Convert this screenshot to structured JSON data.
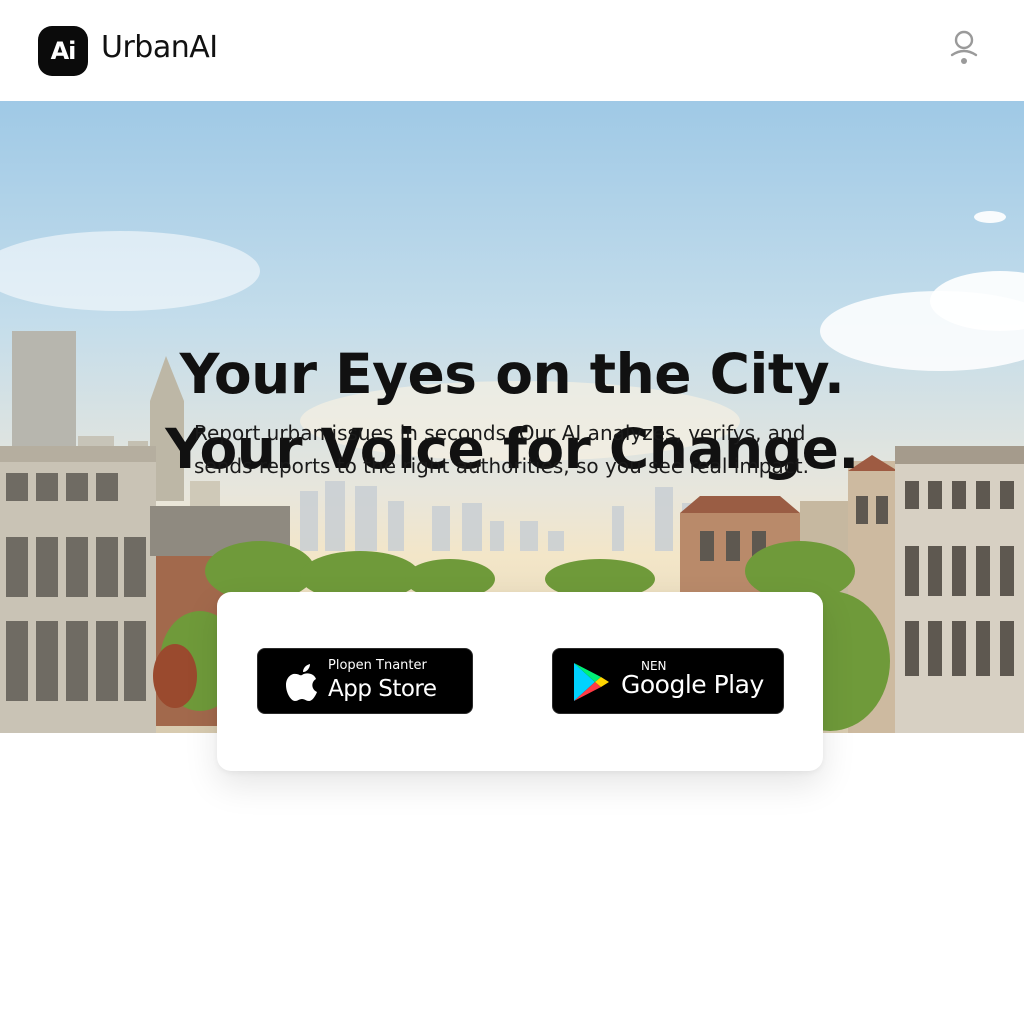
{
  "header": {
    "logo_text": "Ai",
    "brand_name": "UrbanAI",
    "profile_icon": "user-icon"
  },
  "hero": {
    "headline_line1": "Your Eyes on the City.",
    "headline_line2": "Your Voice for Change.",
    "subtext_line1": "Report urban issues in seconds. Our AI analyzes, verifys, and",
    "subtext_line2": "sends reports to the right authorities, so you see real impact."
  },
  "store_buttons": {
    "apple": {
      "small_label": "Plopen Tnanter",
      "big_label": "App Store",
      "icon": "apple-icon"
    },
    "google": {
      "small_label": "NEN",
      "big_label": "Google Play",
      "icon": "google-play-icon"
    }
  },
  "colors": {
    "sky_top": "#9fc9e6",
    "button_bg": "#000000",
    "text": "#111111"
  }
}
